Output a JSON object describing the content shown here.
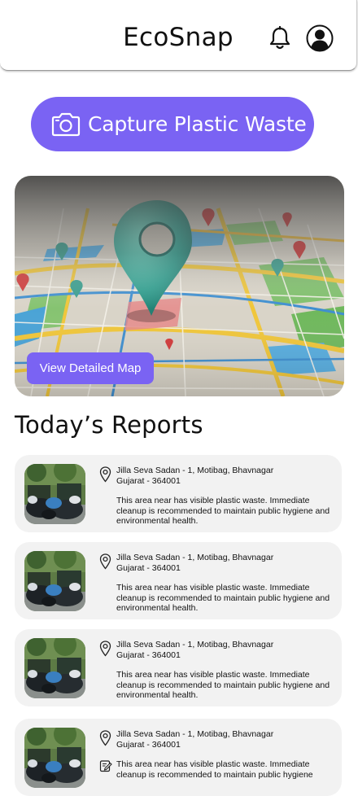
{
  "header": {
    "title": "EcoSnap",
    "notification_icon": "bell-icon",
    "profile_icon": "user-avatar-icon"
  },
  "capture": {
    "label": "Capture Plastic Waste",
    "icon": "camera-icon",
    "color": "#7a63f3"
  },
  "map": {
    "button_label": "View Detailed Map",
    "image": "3d-city-map-with-location-pins"
  },
  "reports_section": {
    "title": "Today’s Reports"
  },
  "reports": [
    {
      "address_line1": "Jilla Seva Sadan - 1, Motibag, Bhavnagar",
      "address_line2": "Gujarat - 364001",
      "description": "This area near has visible plastic waste. Immediate cleanup is recommended to maintain public hygiene and environmental health."
    },
    {
      "address_line1": "Jilla Seva Sadan - 1, Motibag, Bhavnagar",
      "address_line2": "Gujarat - 364001",
      "description": "This area near has visible plastic waste. Immediate cleanup is recommended to maintain public hygiene and environmental health."
    },
    {
      "address_line1": "Jilla Seva Sadan - 1, Motibag, Bhavnagar",
      "address_line2": "Gujarat - 364001",
      "description": "This area near has visible plastic waste. Immediate cleanup is recommended to maintain public hygiene and environmental health."
    },
    {
      "address_line1": "Jilla Seva Sadan - 1, Motibag, Bhavnagar",
      "address_line2": "Gujarat - 364001",
      "description": "This area near has visible plastic waste. Immediate cleanup is recommended to maintain public hygiene"
    }
  ]
}
